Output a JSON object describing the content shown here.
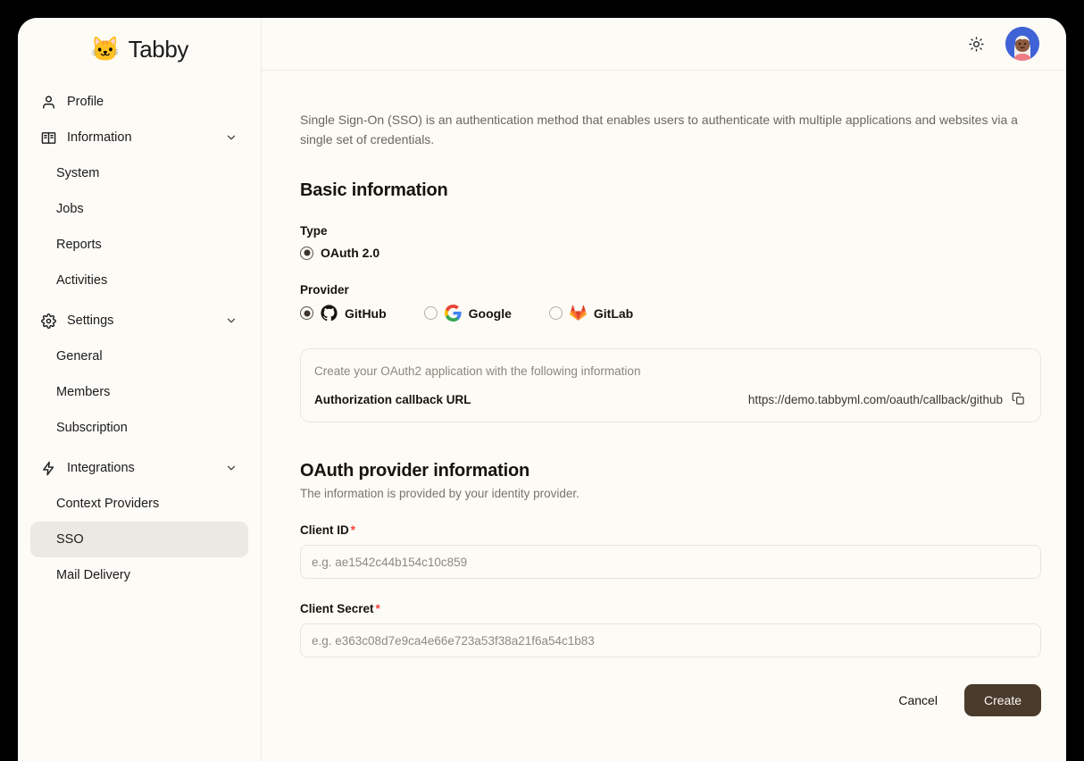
{
  "brand": {
    "logo_icon": "cat-logo-icon",
    "name": "Tabby"
  },
  "sidebar": {
    "items": [
      {
        "label": "Profile",
        "icon": "user-icon",
        "type": "link"
      },
      {
        "label": "Information",
        "icon": "book-icon",
        "type": "group",
        "chevron": "chevron-down-icon"
      },
      {
        "label": "System",
        "type": "sub"
      },
      {
        "label": "Jobs",
        "type": "sub"
      },
      {
        "label": "Reports",
        "type": "sub"
      },
      {
        "label": "Activities",
        "type": "sub"
      },
      {
        "label": "Settings",
        "icon": "gear-icon",
        "type": "group",
        "chevron": "chevron-down-icon"
      },
      {
        "label": "General",
        "type": "sub"
      },
      {
        "label": "Members",
        "type": "sub"
      },
      {
        "label": "Subscription",
        "type": "sub"
      },
      {
        "label": "Integrations",
        "icon": "bolt-icon",
        "type": "group",
        "chevron": "chevron-down-icon"
      },
      {
        "label": "Context Providers",
        "type": "sub"
      },
      {
        "label": "SSO",
        "type": "sub",
        "active": true
      },
      {
        "label": "Mail Delivery",
        "type": "sub"
      }
    ]
  },
  "topbar": {
    "theme_toggle_icon": "sun-icon",
    "avatar_icon": "user-avatar"
  },
  "main": {
    "intro": "Single Sign-On (SSO) is an authentication method that enables users to authenticate with multiple applications and websites via a single set of credentials.",
    "basic_information": {
      "title": "Basic information",
      "type_label": "Type",
      "type_options": [
        {
          "label": "OAuth 2.0",
          "selected": true
        }
      ],
      "provider_label": "Provider",
      "provider_options": [
        {
          "label": "GitHub",
          "icon": "github-logo",
          "selected": true
        },
        {
          "label": "Google",
          "icon": "google-logo",
          "selected": false
        },
        {
          "label": "GitLab",
          "icon": "gitlab-logo",
          "selected": false
        }
      ]
    },
    "callback_card": {
      "hint": "Create your OAuth2 application with the following information",
      "key": "Authorization callback URL",
      "value": "https://demo.tabbyml.com/oauth/callback/github",
      "copy_icon": "copy-icon"
    },
    "provider_information": {
      "title": "OAuth provider information",
      "subtitle": "The information is provided by your identity provider.",
      "client_id_label": "Client ID",
      "client_id_required": "*",
      "client_id_value": "",
      "client_id_placeholder": "e.g. ae1542c44b154c10c859",
      "client_secret_label": "Client Secret",
      "client_secret_required": "*",
      "client_secret_value": "",
      "client_secret_placeholder": "e.g. e363c08d7e9ca4e66e723a53f38a21f6a54c1b83"
    },
    "actions": {
      "cancel_label": "Cancel",
      "create_label": "Create"
    }
  },
  "colors": {
    "window_bg": "#fdfbf6",
    "outer_bg": "#000000",
    "accent_button": "#4a3b2c",
    "required_star": "#f2413c",
    "active_nav": "#ebe9e3"
  }
}
